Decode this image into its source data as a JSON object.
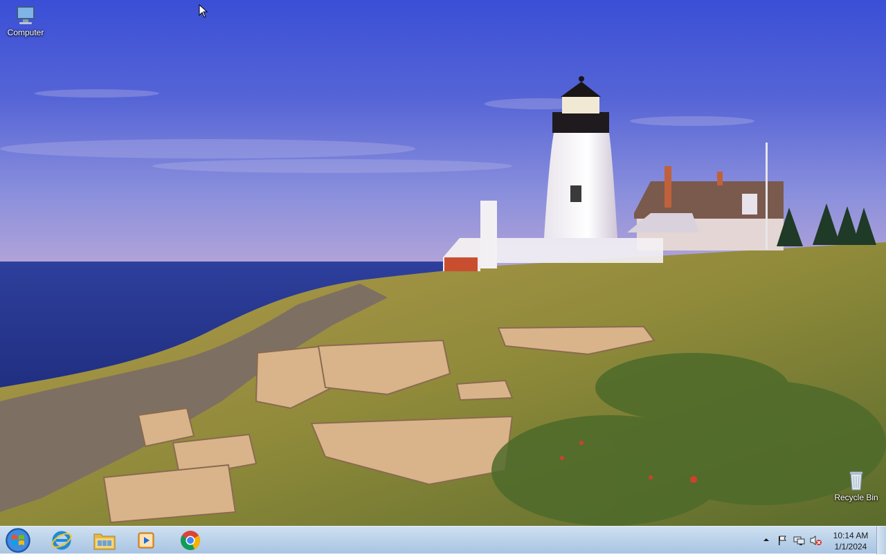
{
  "desktop": {
    "icons": [
      {
        "label": "Computer",
        "icon": "computer-icon"
      },
      {
        "label": "Recycle Bin",
        "icon": "recycle-bin-icon"
      }
    ]
  },
  "taskbar": {
    "start": {
      "icon": "windows-logo-icon"
    },
    "pinned": [
      {
        "icon": "internet-explorer-icon"
      },
      {
        "icon": "file-explorer-icon"
      },
      {
        "icon": "media-player-icon"
      },
      {
        "icon": "chrome-icon"
      }
    ],
    "tray": {
      "icons": [
        "show-hidden-icons-arrow-icon",
        "action-center-flag-icon",
        "network-icon",
        "volume-muted-icon"
      ],
      "time": "10:14 AM",
      "date": "1/1/2024"
    }
  },
  "colors": {
    "sky_top": "#3f54d6",
    "sea": "#283f9c",
    "taskbar": "#bcd3ea"
  }
}
